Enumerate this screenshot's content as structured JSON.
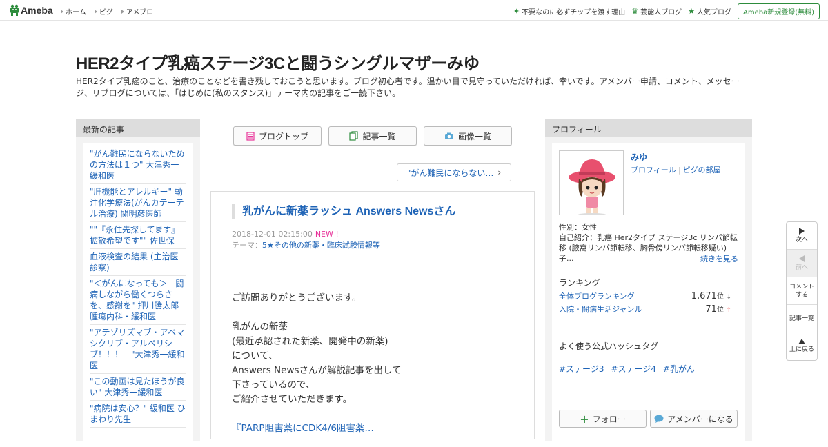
{
  "header": {
    "logo_text": "Ameba",
    "nav": [
      "ホーム",
      "ピグ",
      "アメブロ"
    ],
    "right_links": [
      "不要なのに必ずチップを渡す理由",
      "芸能人ブログ",
      "人気ブログ"
    ],
    "signup_label": "Ameba新規登録(無料)",
    "accent_color": "#2d8c3c"
  },
  "blog": {
    "title": "HER2タイプ乳癌ステージ3Cと闘うシングルマザーみゆ",
    "description": "HER2タイプ乳癌のこと、治療のことなどを書き残しておこうと思います。ブログ初心者です。温かい目で見守っていただければ、幸いです。アメンバー申請、コメント、メッセージ、リブログについては、「はじめに(私のスタンス)」テーマ内の記事をご一読下さい。"
  },
  "left_sidebar": {
    "heading": "最新の記事",
    "items": [
      "\"がん難民にならないための方法は１つ\" 大津秀一緩和医",
      "\"肝機能とアレルギー\" 動注化学療法(がんカテーテル治療) 関明彦医師",
      "\"\"『永住先探してます』拡散希望です\"\" 佐世保",
      "血液検査の結果 (主治医診察)",
      "\"＜がんになっても＞　闘病しながら働くつらさを、感謝を\" 押川勝太郎 腫瘍内科・緩和医",
      "\"アテゾリズマブ・アベマシクリブ・アルペリシブ！！！　\"大津秀一緩和医",
      "\"この動画は見たほうが良い\" 大津秀一緩和医",
      "\"病院は安心？\" 緩和医 ひまわり先生"
    ]
  },
  "center": {
    "buttons": [
      "ブログトップ",
      "記事一覧",
      "画像一覧"
    ],
    "next_article": "\"がん難民にならない…",
    "article": {
      "title": "乳がんに新薬ラッシュ Answers Newsさん",
      "date": "2018-12-01 02:15:00",
      "new_label": "NEW !",
      "theme_label": "テーマ：",
      "theme": "5★その他の新薬・臨床試験情報等",
      "body_lines": [
        "ご訪問ありがとうございます。",
        "",
        "乳がんの新薬",
        "(最近承認された新薬、開発中の新薬)",
        "について、",
        "Answers Newsさんが解説記事を出して",
        "下さっているので、",
        "ご紹介させていただきます。"
      ],
      "link_text": "『PARP阻害薬にCDK4/6阻害薬…"
    }
  },
  "right_sidebar": {
    "heading": "プロフィール",
    "name": "みゆ",
    "link_profile": "プロフィール",
    "link_pig": "ピグの部屋",
    "gender": "性別：女性",
    "intro": "自己紹介：乳癌 Her2タイプ ステージ3c リンパ節転移 (腋窩リンパ節転移、胸骨傍リンパ節転移疑い) 子...",
    "more_label": "続きを見る",
    "ranking_heading": "ランキング",
    "rankings": [
      {
        "label": "全体ブログランキング",
        "value": "1,671",
        "unit": "位",
        "trend": "↓"
      },
      {
        "label": "入院・闘病生活ジャンル",
        "value": "71",
        "unit": "位",
        "trend": "↑"
      }
    ],
    "hashtag_heading": "よく使う公式ハッシュタグ",
    "hashtags": [
      "#ステージ3",
      "#ステージ4",
      "#乳がん"
    ],
    "follow_label": "フォロー",
    "amember_label": "アメンバーになる"
  },
  "floatnav": {
    "next": "次へ",
    "prev": "前へ",
    "comment": "コメントする",
    "list": "記事一覧",
    "top": "上に戻る"
  }
}
